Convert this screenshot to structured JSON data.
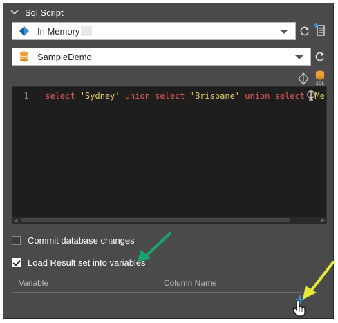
{
  "section": {
    "title": "Sql Script"
  },
  "connection_type": {
    "value": "In Memory",
    "icon": "diamond-icon"
  },
  "data_source": {
    "value": "SampleDemo",
    "icon": "database-icon"
  },
  "editor": {
    "line_number": "1",
    "tokens": [
      {
        "text": "select ",
        "kind": "kw"
      },
      {
        "text": "'Sydney'",
        "kind": "str"
      },
      {
        "text": " union ",
        "kind": "kw"
      },
      {
        "text": "select ",
        "kind": "kw"
      },
      {
        "text": "'Brisbane'",
        "kind": "str"
      },
      {
        "text": " union ",
        "kind": "kw"
      },
      {
        "text": "select ",
        "kind": "kw"
      },
      {
        "text": "'Melb",
        "kind": "str"
      }
    ]
  },
  "options": {
    "commit_label": "Commit database changes",
    "commit_checked": false,
    "load_label": "Load Result set into variables",
    "load_checked": true
  },
  "grid": {
    "col_variable": "Variable",
    "col_column_name": "Column Name"
  },
  "colors": {
    "panel_bg": "#4a4a4a",
    "editor_bg": "#1e1e1e",
    "keyword": "#e05a56",
    "string": "#e6c76a",
    "accent_blue": "#3a8fd8",
    "annotation_green": "#1aa36a",
    "annotation_yellow": "#e8e83a"
  }
}
